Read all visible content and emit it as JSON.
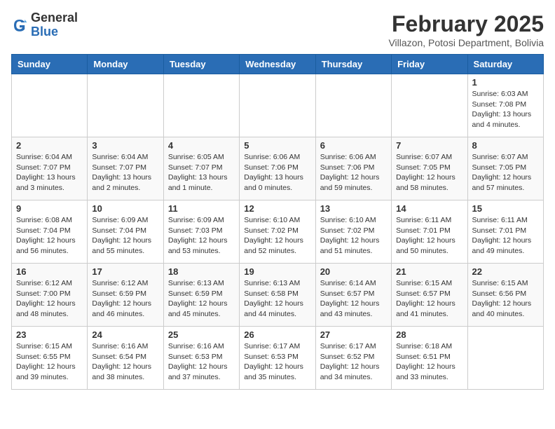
{
  "header": {
    "logo_general": "General",
    "logo_blue": "Blue",
    "month_year": "February 2025",
    "location": "Villazon, Potosi Department, Bolivia"
  },
  "weekdays": [
    "Sunday",
    "Monday",
    "Tuesday",
    "Wednesday",
    "Thursday",
    "Friday",
    "Saturday"
  ],
  "weeks": [
    [
      {
        "day": "",
        "info": ""
      },
      {
        "day": "",
        "info": ""
      },
      {
        "day": "",
        "info": ""
      },
      {
        "day": "",
        "info": ""
      },
      {
        "day": "",
        "info": ""
      },
      {
        "day": "",
        "info": ""
      },
      {
        "day": "1",
        "info": "Sunrise: 6:03 AM\nSunset: 7:08 PM\nDaylight: 13 hours and 4 minutes."
      }
    ],
    [
      {
        "day": "2",
        "info": "Sunrise: 6:04 AM\nSunset: 7:07 PM\nDaylight: 13 hours and 3 minutes."
      },
      {
        "day": "3",
        "info": "Sunrise: 6:04 AM\nSunset: 7:07 PM\nDaylight: 13 hours and 2 minutes."
      },
      {
        "day": "4",
        "info": "Sunrise: 6:05 AM\nSunset: 7:07 PM\nDaylight: 13 hours and 1 minute."
      },
      {
        "day": "5",
        "info": "Sunrise: 6:06 AM\nSunset: 7:06 PM\nDaylight: 13 hours and 0 minutes."
      },
      {
        "day": "6",
        "info": "Sunrise: 6:06 AM\nSunset: 7:06 PM\nDaylight: 12 hours and 59 minutes."
      },
      {
        "day": "7",
        "info": "Sunrise: 6:07 AM\nSunset: 7:05 PM\nDaylight: 12 hours and 58 minutes."
      },
      {
        "day": "8",
        "info": "Sunrise: 6:07 AM\nSunset: 7:05 PM\nDaylight: 12 hours and 57 minutes."
      }
    ],
    [
      {
        "day": "9",
        "info": "Sunrise: 6:08 AM\nSunset: 7:04 PM\nDaylight: 12 hours and 56 minutes."
      },
      {
        "day": "10",
        "info": "Sunrise: 6:09 AM\nSunset: 7:04 PM\nDaylight: 12 hours and 55 minutes."
      },
      {
        "day": "11",
        "info": "Sunrise: 6:09 AM\nSunset: 7:03 PM\nDaylight: 12 hours and 53 minutes."
      },
      {
        "day": "12",
        "info": "Sunrise: 6:10 AM\nSunset: 7:02 PM\nDaylight: 12 hours and 52 minutes."
      },
      {
        "day": "13",
        "info": "Sunrise: 6:10 AM\nSunset: 7:02 PM\nDaylight: 12 hours and 51 minutes."
      },
      {
        "day": "14",
        "info": "Sunrise: 6:11 AM\nSunset: 7:01 PM\nDaylight: 12 hours and 50 minutes."
      },
      {
        "day": "15",
        "info": "Sunrise: 6:11 AM\nSunset: 7:01 PM\nDaylight: 12 hours and 49 minutes."
      }
    ],
    [
      {
        "day": "16",
        "info": "Sunrise: 6:12 AM\nSunset: 7:00 PM\nDaylight: 12 hours and 48 minutes."
      },
      {
        "day": "17",
        "info": "Sunrise: 6:12 AM\nSunset: 6:59 PM\nDaylight: 12 hours and 46 minutes."
      },
      {
        "day": "18",
        "info": "Sunrise: 6:13 AM\nSunset: 6:59 PM\nDaylight: 12 hours and 45 minutes."
      },
      {
        "day": "19",
        "info": "Sunrise: 6:13 AM\nSunset: 6:58 PM\nDaylight: 12 hours and 44 minutes."
      },
      {
        "day": "20",
        "info": "Sunrise: 6:14 AM\nSunset: 6:57 PM\nDaylight: 12 hours and 43 minutes."
      },
      {
        "day": "21",
        "info": "Sunrise: 6:15 AM\nSunset: 6:57 PM\nDaylight: 12 hours and 41 minutes."
      },
      {
        "day": "22",
        "info": "Sunrise: 6:15 AM\nSunset: 6:56 PM\nDaylight: 12 hours and 40 minutes."
      }
    ],
    [
      {
        "day": "23",
        "info": "Sunrise: 6:15 AM\nSunset: 6:55 PM\nDaylight: 12 hours and 39 minutes."
      },
      {
        "day": "24",
        "info": "Sunrise: 6:16 AM\nSunset: 6:54 PM\nDaylight: 12 hours and 38 minutes."
      },
      {
        "day": "25",
        "info": "Sunrise: 6:16 AM\nSunset: 6:53 PM\nDaylight: 12 hours and 37 minutes."
      },
      {
        "day": "26",
        "info": "Sunrise: 6:17 AM\nSunset: 6:53 PM\nDaylight: 12 hours and 35 minutes."
      },
      {
        "day": "27",
        "info": "Sunrise: 6:17 AM\nSunset: 6:52 PM\nDaylight: 12 hours and 34 minutes."
      },
      {
        "day": "28",
        "info": "Sunrise: 6:18 AM\nSunset: 6:51 PM\nDaylight: 12 hours and 33 minutes."
      },
      {
        "day": "",
        "info": ""
      }
    ]
  ]
}
